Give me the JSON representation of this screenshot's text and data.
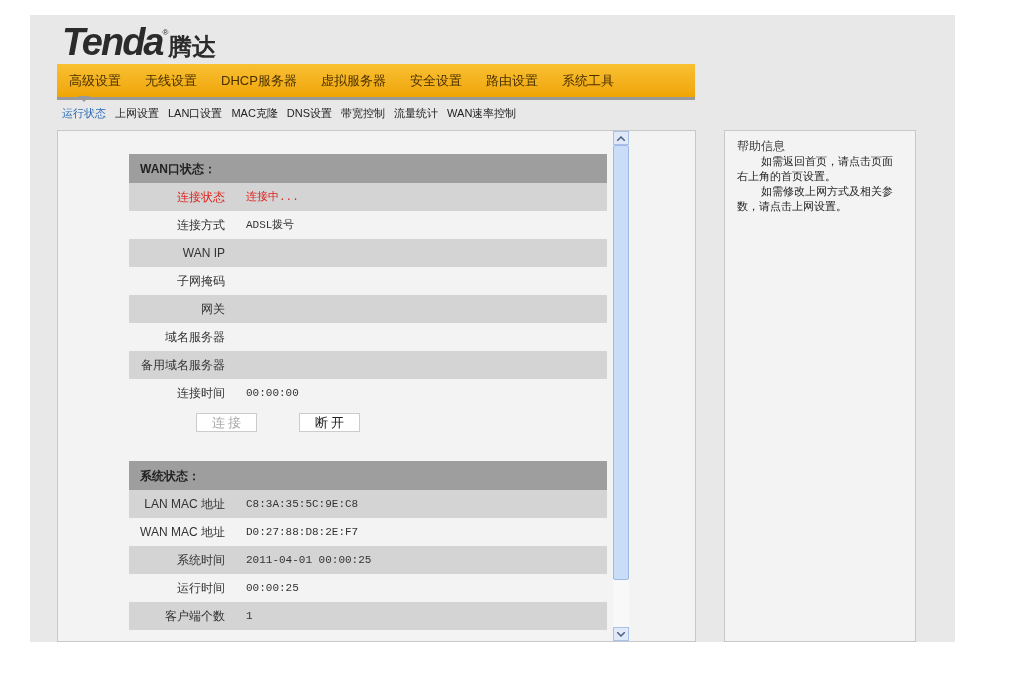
{
  "logo": {
    "brand": "Tenda",
    "mark": "®",
    "cn": "腾达"
  },
  "main_nav": [
    {
      "label": "高级设置"
    },
    {
      "label": "无线设置"
    },
    {
      "label": "DHCP服务器"
    },
    {
      "label": "虚拟服务器"
    },
    {
      "label": "安全设置"
    },
    {
      "label": "路由设置"
    },
    {
      "label": "系统工具"
    }
  ],
  "sub_nav": [
    {
      "label": "运行状态",
      "selected": true
    },
    {
      "label": "上网设置",
      "selected": false
    },
    {
      "label": "LAN口设置",
      "selected": false
    },
    {
      "label": "MAC克隆",
      "selected": false
    },
    {
      "label": "DNS设置",
      "selected": false
    },
    {
      "label": "带宽控制",
      "selected": false
    },
    {
      "label": "流量统计",
      "selected": false
    },
    {
      "label": "WAN速率控制",
      "selected": false
    }
  ],
  "sections": [
    {
      "title": "WAN口状态：",
      "rows": [
        {
          "label": "连接状态",
          "value": "连接中...",
          "alert": true
        },
        {
          "label": "连接方式",
          "value": "ADSL拨号",
          "alert": false
        },
        {
          "label": "WAN IP",
          "alert": false
        },
        {
          "label": "子网掩码",
          "alert": false
        },
        {
          "label": "网关",
          "alert": false
        },
        {
          "label": "域名服务器",
          "alert": false
        },
        {
          "label": "备用域名服务器",
          "alert": false
        },
        {
          "label": "连接时间",
          "value": "00:00:00",
          "alert": false
        }
      ],
      "buttons": [
        {
          "label": "连 接",
          "disabled": true
        },
        {
          "label": "断 开",
          "disabled": false
        }
      ]
    },
    {
      "title": "系统状态：",
      "rows": [
        {
          "label": "LAN MAC 地址",
          "value": "C8:3A:35:5C:9E:C8",
          "alert": false
        },
        {
          "label": "WAN MAC 地址",
          "value": "D0:27:88:D8:2E:F7",
          "alert": false
        },
        {
          "label": "系统时间",
          "value": "2011-04-01 00:00:25",
          "alert": false
        },
        {
          "label": "运行时间",
          "value": "00:00:25",
          "alert": false
        },
        {
          "label": "客户端个数",
          "value": "1",
          "alert": false
        }
      ]
    }
  ],
  "help": {
    "title": "帮助信息",
    "paragraphs": [
      "如需返回首页，请点击页面右上角的首页设置。",
      "如需修改上网方式及相关参数，请点击上网设置。"
    ]
  }
}
